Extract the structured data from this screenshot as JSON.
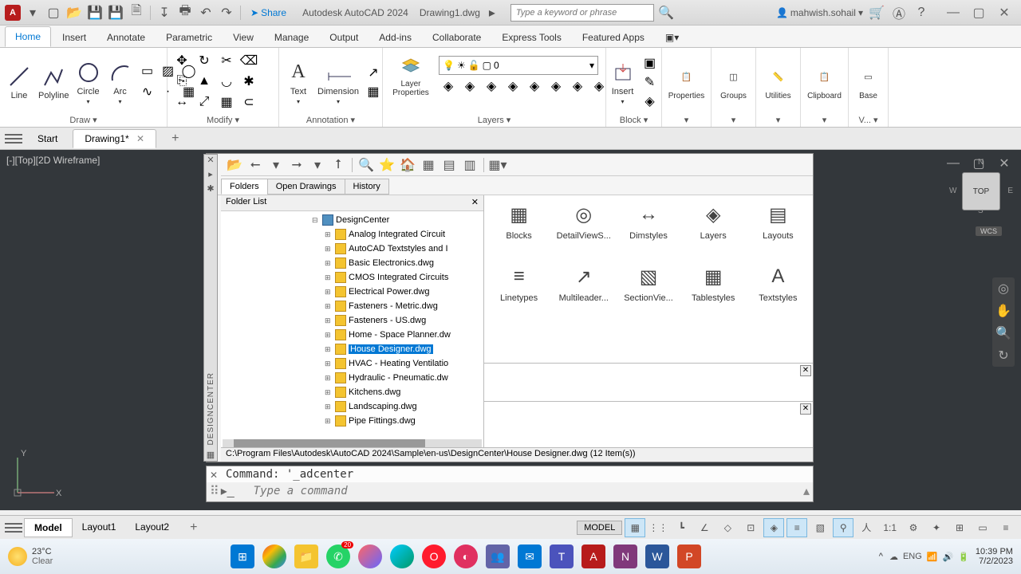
{
  "title": {
    "app": "Autodesk AutoCAD 2024",
    "file": "Drawing1.dwg",
    "share": "Share",
    "search_placeholder": "Type a keyword or phrase",
    "user": "mahwish.sohail"
  },
  "ribbon_tabs": [
    "Home",
    "Insert",
    "Annotate",
    "Parametric",
    "View",
    "Manage",
    "Output",
    "Add-ins",
    "Collaborate",
    "Express Tools",
    "Featured Apps"
  ],
  "ribbon_active": 0,
  "panels": {
    "draw": {
      "label": "Draw",
      "tools": [
        "Line",
        "Polyline",
        "Circle",
        "Arc"
      ]
    },
    "modify": {
      "label": "Modify"
    },
    "annotation": {
      "label": "Annotation",
      "tools": [
        "Text",
        "Dimension"
      ]
    },
    "layers": {
      "label": "Layers",
      "prop": "Layer Properties",
      "current": "0"
    },
    "block": {
      "label": "Block",
      "insert": "Insert"
    },
    "properties": {
      "label": "Properties"
    },
    "groups": {
      "label": "Groups"
    },
    "utilities": {
      "label": "Utilities"
    },
    "clipboard": {
      "label": "Clipboard"
    },
    "view": {
      "label": "V...",
      "base": "Base"
    }
  },
  "file_tabs": {
    "start": "Start",
    "active": "Drawing1*"
  },
  "viewport": {
    "label": "[-][Top][2D Wireframe]",
    "cube": "TOP",
    "wcs": "WCS",
    "dirs": {
      "n": "N",
      "s": "S",
      "e": "E",
      "w": "W"
    }
  },
  "dc": {
    "title": "DESIGNCENTER",
    "subtabs": [
      "Folders",
      "Open Drawings",
      "History"
    ],
    "subtab_active": 0,
    "tree_header": "Folder List",
    "root": "DesignCenter",
    "items": [
      "Analog Integrated Circuit",
      "AutoCAD Textstyles and I",
      "Basic Electronics.dwg",
      "CMOS Integrated Circuits",
      "Electrical Power.dwg",
      "Fasteners - Metric.dwg",
      "Fasteners - US.dwg",
      "Home - Space Planner.dw",
      "House Designer.dwg",
      "HVAC - Heating Ventilatio",
      "Hydraulic - Pneumatic.dw",
      "Kitchens.dwg",
      "Landscaping.dwg",
      "Pipe Fittings.dwg"
    ],
    "selected_index": 8,
    "categories": [
      "Blocks",
      "DetailViewS...",
      "Dimstyles",
      "Layers",
      "Layouts",
      "Linetypes",
      "Multileader...",
      "SectionVie...",
      "Tablestyles",
      "Textstyles"
    ],
    "path": "C:\\Program Files\\Autodesk\\AutoCAD 2024\\Sample\\en-us\\DesignCenter\\House Designer.dwg (12 Item(s))"
  },
  "cmd": {
    "output": "Command: '_adcenter",
    "placeholder": "Type a command"
  },
  "bottom_tabs": [
    "Model",
    "Layout1",
    "Layout2"
  ],
  "bottom_active": 0,
  "status": {
    "model": "MODEL",
    "scale": "1:1"
  },
  "taskbar": {
    "weather_temp": "23°C",
    "weather_desc": "Clear",
    "time": "10:39 PM",
    "date": "7/2/2023",
    "lang": "ENG"
  }
}
